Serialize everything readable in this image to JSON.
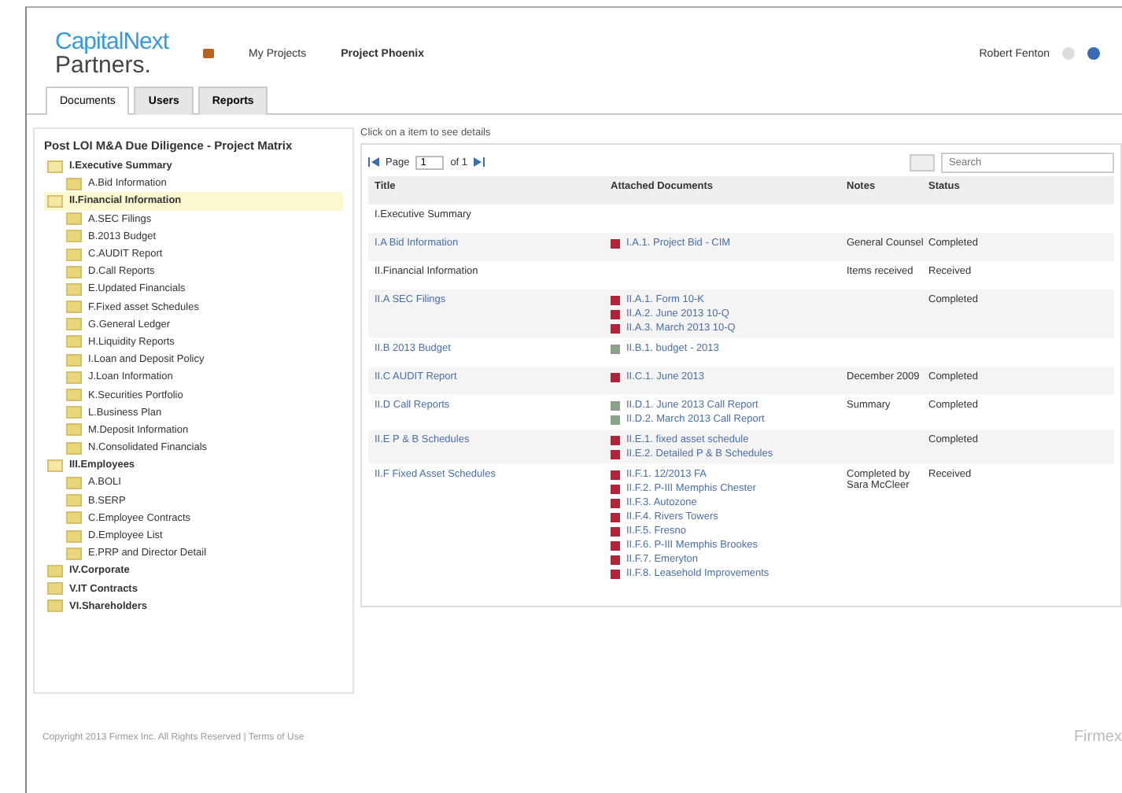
{
  "header": {
    "logo_top": "CapitalNext",
    "logo_bottom": "Partners.",
    "breadcrumb": [
      "My Projects",
      "Project Phoenix"
    ],
    "user": "Robert Fenton"
  },
  "tabs": [
    {
      "label": "Documents",
      "selected": true
    },
    {
      "label": "Users",
      "selected": false
    },
    {
      "label": "Reports",
      "selected": false
    }
  ],
  "tree": {
    "title": "Post LOI M&A Due Diligence - Project Matrix",
    "items": [
      {
        "label": "I.Executive Summary",
        "expanded": true,
        "selected": false,
        "children": [
          {
            "label": "A.Bid Information"
          }
        ]
      },
      {
        "label": "II.Financial Information",
        "expanded": true,
        "selected": true,
        "children": [
          {
            "label": "A.SEC Filings"
          },
          {
            "label": "B.2013 Budget"
          },
          {
            "label": "C.AUDIT Report"
          },
          {
            "label": "D.Call Reports"
          },
          {
            "label": "E.Updated Financials"
          },
          {
            "label": "F.Fixed asset Schedules"
          },
          {
            "label": "G.General Ledger"
          },
          {
            "label": "H.Liquidity Reports"
          },
          {
            "label": "I.Loan and Deposit Policy"
          },
          {
            "label": "J.Loan Information"
          },
          {
            "label": "K.Securities Portfolio"
          },
          {
            "label": "L.Business Plan"
          },
          {
            "label": "M.Deposit Information"
          },
          {
            "label": "N.Consolidated Financials"
          }
        ]
      },
      {
        "label": "III.Employees",
        "expanded": true,
        "selected": false,
        "children": [
          {
            "label": "A.BOLI"
          },
          {
            "label": "B.SERP"
          },
          {
            "label": "C.Employee Contracts"
          },
          {
            "label": "D.Employee List"
          },
          {
            "label": "E.PRP and Director Detail"
          }
        ]
      },
      {
        "label": "IV.Corporate",
        "expanded": false,
        "selected": false
      },
      {
        "label": "V.IT Contracts",
        "expanded": false,
        "selected": false
      },
      {
        "label": "VI.Shareholders",
        "expanded": false,
        "selected": false
      }
    ]
  },
  "hint": "Click on a item to see details",
  "pager": {
    "label": "Page",
    "page": "1",
    "of": "of 1"
  },
  "search": {
    "placeholder": "Search"
  },
  "table": {
    "columns": [
      "Title",
      "Attached Documents",
      "Notes",
      "Status"
    ],
    "rows": [
      {
        "kind": "group",
        "title": "I.Executive Summary"
      },
      {
        "kind": "item",
        "title": "I.A Bid Information",
        "docs": [
          {
            "kind": "pdf",
            "name": "I.A.1. Project Bid - CIM"
          }
        ],
        "notes": "General Counsel",
        "status": "Completed"
      },
      {
        "kind": "group",
        "title": "II.Financial Information",
        "notes": "Items received",
        "status": "Received"
      },
      {
        "kind": "item",
        "title": "II.A SEC Filings",
        "docs": [
          {
            "kind": "pdf",
            "name": "II.A.1. Form 10-K"
          },
          {
            "kind": "pdf",
            "name": "II.A.2. June 2013 10-Q"
          },
          {
            "kind": "pdf",
            "name": "II.A.3. March 2013 10-Q"
          }
        ],
        "status": "Completed"
      },
      {
        "kind": "item",
        "title": "II.B 2013 Budget",
        "docs": [
          {
            "kind": "sheet",
            "name": "II.B.1. budget - 2013"
          }
        ]
      },
      {
        "kind": "item",
        "title": "II.C AUDIT Report",
        "docs": [
          {
            "kind": "pdf",
            "name": "II.C.1. June 2013"
          }
        ],
        "notes": "December 2009",
        "status": "Completed"
      },
      {
        "kind": "item",
        "title": "II.D Call Reports",
        "docs": [
          {
            "kind": "sheet",
            "name": "II.D.1. June 2013 Call Report"
          },
          {
            "kind": "sheet",
            "name": "II.D.2. March 2013 Call Report"
          }
        ],
        "notes": "Summary",
        "status": "Completed"
      },
      {
        "kind": "item",
        "title": "II.E P & B Schedules",
        "docs": [
          {
            "kind": "pdf",
            "name": "II.E.1. fixed asset schedule"
          },
          {
            "kind": "pdf",
            "name": "II.E.2. Detailed P & B Schedules"
          }
        ],
        "status": "Completed"
      },
      {
        "kind": "item",
        "title": "II.F Fixed Asset Schedules",
        "docs": [
          {
            "kind": "pdf",
            "name": "II.F.1. 12/2013 FA"
          },
          {
            "kind": "pdf",
            "name": "II.F.2. P-III Memphis Chester"
          },
          {
            "kind": "pdf",
            "name": "II.F.3. Autozone"
          },
          {
            "kind": "pdf",
            "name": "II.F.4. Rivers Towers"
          },
          {
            "kind": "pdf",
            "name": "II.F.5. Fresno"
          },
          {
            "kind": "pdf",
            "name": "II.F.6. P-III Memphis Brookes"
          },
          {
            "kind": "pdf",
            "name": "II.F.7. Emeryton"
          },
          {
            "kind": "pdf",
            "name": "II.F.8. Leasehold Improvements"
          }
        ],
        "notes": "Completed by Sara McCleer",
        "status": "Received"
      }
    ]
  },
  "footer": {
    "copyright": "Copyright 2013 Firmex Inc. All Rights Reserved | Terms of Use",
    "brand": "Firmex"
  }
}
